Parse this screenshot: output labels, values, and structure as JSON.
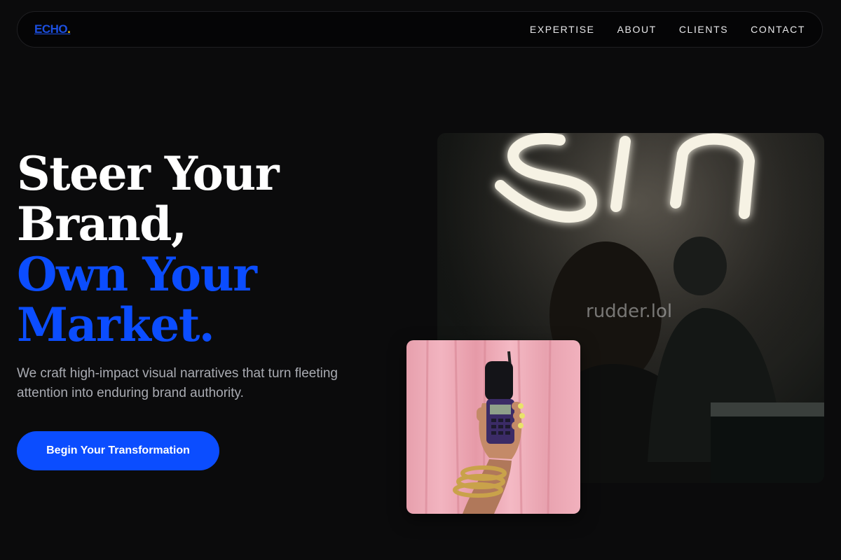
{
  "nav": {
    "logo_text": "ECHO",
    "logo_dot": ".",
    "links": [
      {
        "label": "EXPERTISE"
      },
      {
        "label": "ABOUT"
      },
      {
        "label": "CLIENTS"
      },
      {
        "label": "CONTACT"
      }
    ]
  },
  "hero": {
    "headline_line1": "Steer Your",
    "headline_line2": "Brand,",
    "headline_line3": "Own Your",
    "headline_line4": "Market.",
    "subtext": "We craft high-impact visual narratives that turn fleeting attention into enduring brand authority.",
    "cta_label": "Begin Your Transformation",
    "watermark": "rudder.lol"
  },
  "colors": {
    "background": "#0b0b0c",
    "accent": "#0b4dff",
    "logo": "#1c4fe0",
    "logo_dot": "#f0c419",
    "subtext": "#a9abb2"
  },
  "images": {
    "main": "neon-sign-photo",
    "small": "retro-phone-hand-photo"
  }
}
